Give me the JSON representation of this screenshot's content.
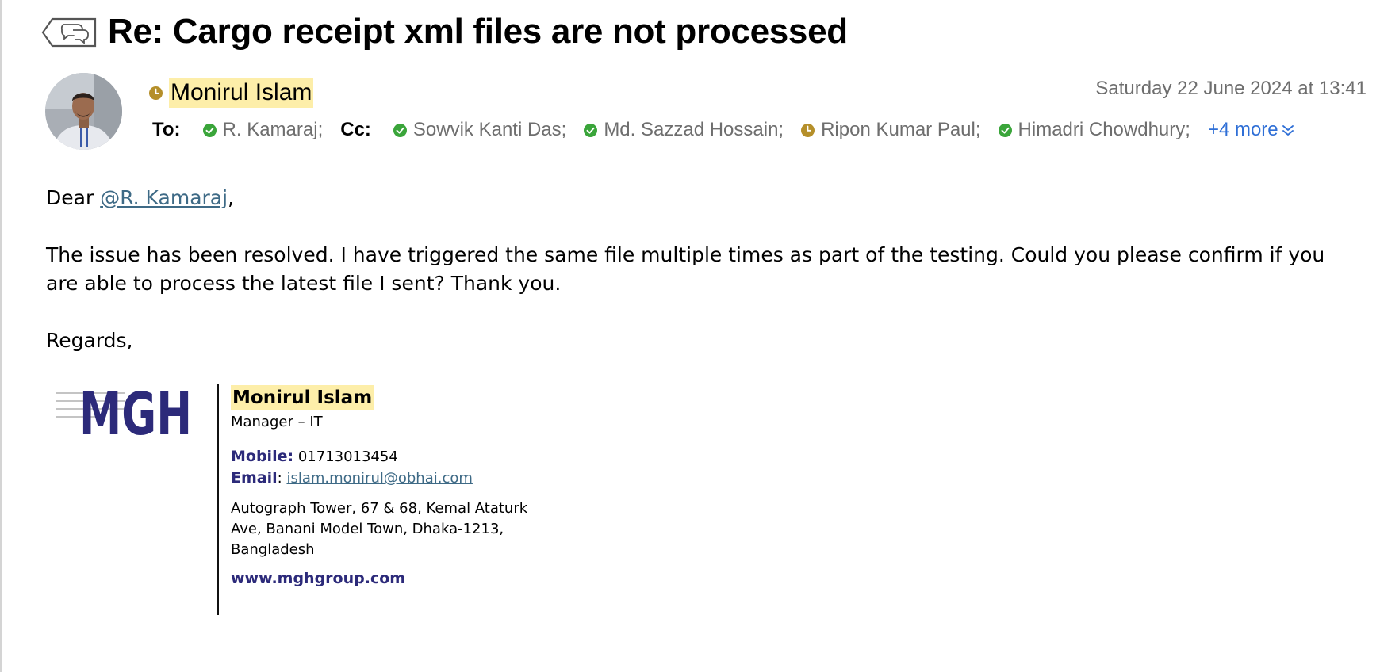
{
  "email": {
    "subject": "Re: Cargo receipt xml files are not processed",
    "sender": {
      "name": "Monirul Islam",
      "status": "away"
    },
    "date": "Saturday 22 June 2024 at 13:41",
    "to_label": "To:",
    "cc_label": "Cc:",
    "to": [
      {
        "name": "R. Kamaraj;",
        "status": "available"
      }
    ],
    "cc": [
      {
        "name": "Sowvik Kanti Das;",
        "status": "available"
      },
      {
        "name": "Md. Sazzad Hossain;",
        "status": "available"
      },
      {
        "name": "Ripon Kumar Paul;",
        "status": "away"
      },
      {
        "name": "Himadri Chowdhury;",
        "status": "available"
      }
    ],
    "more_label": "+4 more"
  },
  "body": {
    "greeting_prefix": "Dear ",
    "mention": "@R. Kamaraj",
    "greeting_suffix": ",",
    "paragraph": "The issue has been resolved. I have triggered the same file multiple times as part of the testing. Could you please confirm if you are able to process the latest file I sent? Thank you.",
    "closing": "Regards,"
  },
  "signature": {
    "logo_text": "MGH",
    "name": "Monirul Islam",
    "title": "Manager – IT",
    "mobile_label": "Mobile:",
    "mobile": "01713013454",
    "email_label": "Email",
    "email_sep": ":",
    "email": "islam.monirul@obhai.com",
    "address": "Autograph Tower, 67 & 68, Kemal Ataturk Ave, Banani Model Town, Dhaka-1213, Bangladesh",
    "website": "www.mghgroup.com"
  },
  "icons": {
    "thread": "reply-thread-icon",
    "available": "check-circle-icon",
    "away": "clock-icon",
    "expand": "double-chevron-down-icon"
  },
  "colors": {
    "highlight": "#fdeea9",
    "available": "#3aa53a",
    "away": "#b58f2a",
    "link": "#2f6fd6",
    "mention": "#3e6a86",
    "brand": "#2c2a7a"
  }
}
